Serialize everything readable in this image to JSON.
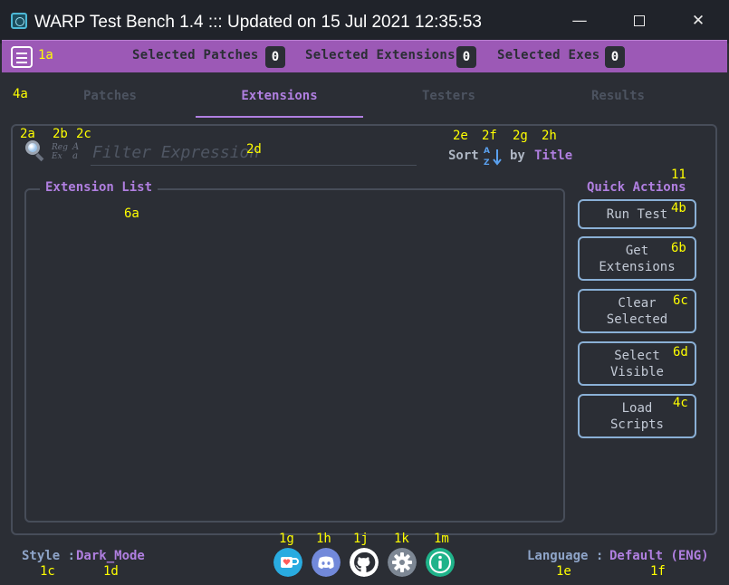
{
  "window": {
    "title": "WARP Test Bench 1.4  :::  Updated on 15 Jul 2021 12:35:53",
    "minimize_glyph": "—",
    "close_glyph": "✕"
  },
  "counters": {
    "patches_label": "Selected Patches",
    "patches_value": "0",
    "extensions_label": "Selected Extensions",
    "extensions_value": "0",
    "exes_label": "Selected Exes",
    "exes_value": "0"
  },
  "tabs": [
    {
      "label": "Patches",
      "active": false
    },
    {
      "label": "Extensions",
      "active": true
    },
    {
      "label": "Testers",
      "active": false
    },
    {
      "label": "Results",
      "active": false
    }
  ],
  "filter": {
    "placeholder": "Filter Expression",
    "value": "",
    "regex_top": "Reg",
    "regex_bottom": "Ex",
    "case_top": "A",
    "case_bottom": "a"
  },
  "sort": {
    "label": "Sort",
    "by_label": "by",
    "field": "Title",
    "icon_top": "A",
    "icon_bottom": "Z"
  },
  "extension_list": {
    "title": "Extension List",
    "items": []
  },
  "quick_actions": {
    "title": "Quick Actions",
    "buttons": [
      {
        "label": "Run Test"
      },
      {
        "label": "Get\nExtensions"
      },
      {
        "label": "Clear\nSelected"
      },
      {
        "label": "Select\nVisible"
      },
      {
        "label": "Load\nScripts"
      }
    ]
  },
  "status": {
    "style_label": "Style :",
    "style_value": "Dark_Mode",
    "language_label": "Language :",
    "language_value": "Default (ENG)"
  },
  "footer_icons": [
    "ko-fi-icon",
    "discord-icon",
    "github-icon",
    "settings-gear-icon",
    "info-icon"
  ],
  "annotations": {
    "a1a": "1a",
    "a4a": "4a",
    "a2a": "2a",
    "a2b": "2b",
    "a2c": "2c",
    "a2d": "2d",
    "a2e": "2e",
    "a2f": "2f",
    "a2g": "2g",
    "a2h": "2h",
    "a11": "11",
    "a6a": "6a",
    "a4b": "4b",
    "a6b": "6b",
    "a6c": "6c",
    "a6d": "6d",
    "a4c": "4c",
    "a1c": "1c",
    "a1d": "1d",
    "a1g": "1g",
    "a1h": "1h",
    "a1j": "1j",
    "a1k": "1k",
    "a1m": "1m",
    "a1e": "1e",
    "a1f": "1f"
  },
  "colors": {
    "accent": "#b07fe0",
    "header_bar": "#9c59b6",
    "background": "#2b2e35",
    "annotation": "#ffff00"
  }
}
